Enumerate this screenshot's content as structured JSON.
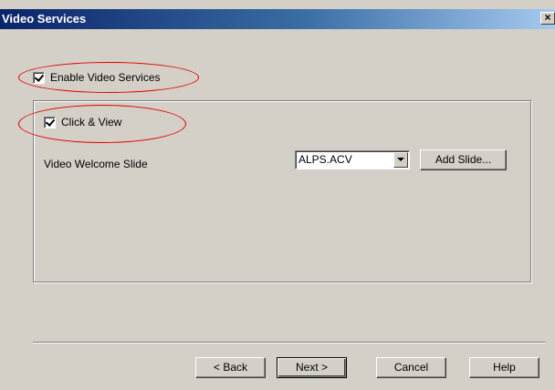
{
  "window": {
    "title": "Video Services",
    "close_glyph": "×"
  },
  "options": {
    "enable_video_services": {
      "label": "Enable Video Services",
      "checked": true
    },
    "click_and_view": {
      "label": "Click & View",
      "checked": true
    }
  },
  "welcome_slide": {
    "label": "Video Welcome Slide",
    "selected_value": "ALPS.ACV",
    "add_slide_label": "Add Slide..."
  },
  "footer": {
    "back_label": "< Back",
    "next_label": "Next >",
    "cancel_label": "Cancel",
    "help_label": "Help"
  },
  "annotations": {
    "highlight_color": "#e00000"
  }
}
